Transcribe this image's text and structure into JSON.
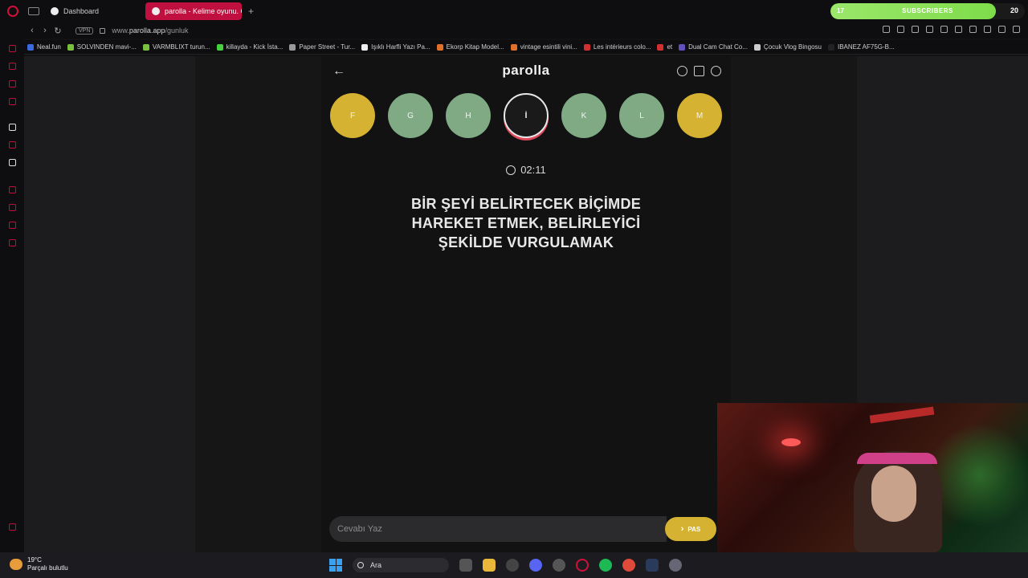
{
  "browser": {
    "tabs": [
      {
        "label": "Dashboard"
      },
      {
        "label": "parolla - Kelime oyunu. G"
      }
    ],
    "new_tab": "+",
    "vpn": "VPN",
    "url_prefix": "www.",
    "url_host": "parolla.app",
    "url_path": "/gunluk",
    "subscribers": {
      "current": "17",
      "label": "SUBSCRIBERS",
      "goal": "20",
      "progress": 0.85
    },
    "bookmarks": [
      {
        "label": "Neal.fun",
        "color": "#3a6ae0"
      },
      {
        "label": "SOLVINDEN mavi-...",
        "color": "#7ac040"
      },
      {
        "label": "VARMBLIXT turun...",
        "color": "#7ac040"
      },
      {
        "label": "killayda - Kick İsta...",
        "color": "#45d040"
      },
      {
        "label": "Paper Street - Tur...",
        "color": "#999999"
      },
      {
        "label": "Işıklı Harfli Yazı Pa...",
        "color": "#eeeeee"
      },
      {
        "label": "Ekorp Kitap Model...",
        "color": "#e0702a"
      },
      {
        "label": "vintage esintili vini...",
        "color": "#e0702a"
      },
      {
        "label": "Les intérieurs colo...",
        "color": "#d03030"
      },
      {
        "label": "et",
        "color": "#d03030"
      },
      {
        "label": "Dual Cam Chat Co...",
        "color": "#6050c0"
      },
      {
        "label": "Çocuk Vlog Bingosu",
        "color": "#cccccc"
      },
      {
        "label": "IBANEZ AF75G-B...",
        "color": "#222222"
      }
    ]
  },
  "game": {
    "title": "parolla",
    "back_icon": "←",
    "letters": [
      {
        "char": "F",
        "state": "yellow"
      },
      {
        "char": "G",
        "state": "green"
      },
      {
        "char": "H",
        "state": "green"
      },
      {
        "char": "İ",
        "state": "current"
      },
      {
        "char": "K",
        "state": "green"
      },
      {
        "char": "L",
        "state": "green"
      },
      {
        "char": "M",
        "state": "yellow"
      }
    ],
    "timer": "02:11",
    "question": "BİR ŞEYİ BELİRTECEK BİÇİMDE HAREKET ETMEK, BELİRLEYİCİ ŞEKİLDE VURGULAMAK",
    "answer_placeholder": "Cevabı Yaz",
    "pass_label": "PAS",
    "pass_icon": "›",
    "colors": {
      "yellow": "#d6b232",
      "green": "#7faa84",
      "current_ring": "#e0485c"
    }
  },
  "taskbar": {
    "temperature": "19°C",
    "weather": "Parçalı bulutlu",
    "search_label": "Ara"
  }
}
